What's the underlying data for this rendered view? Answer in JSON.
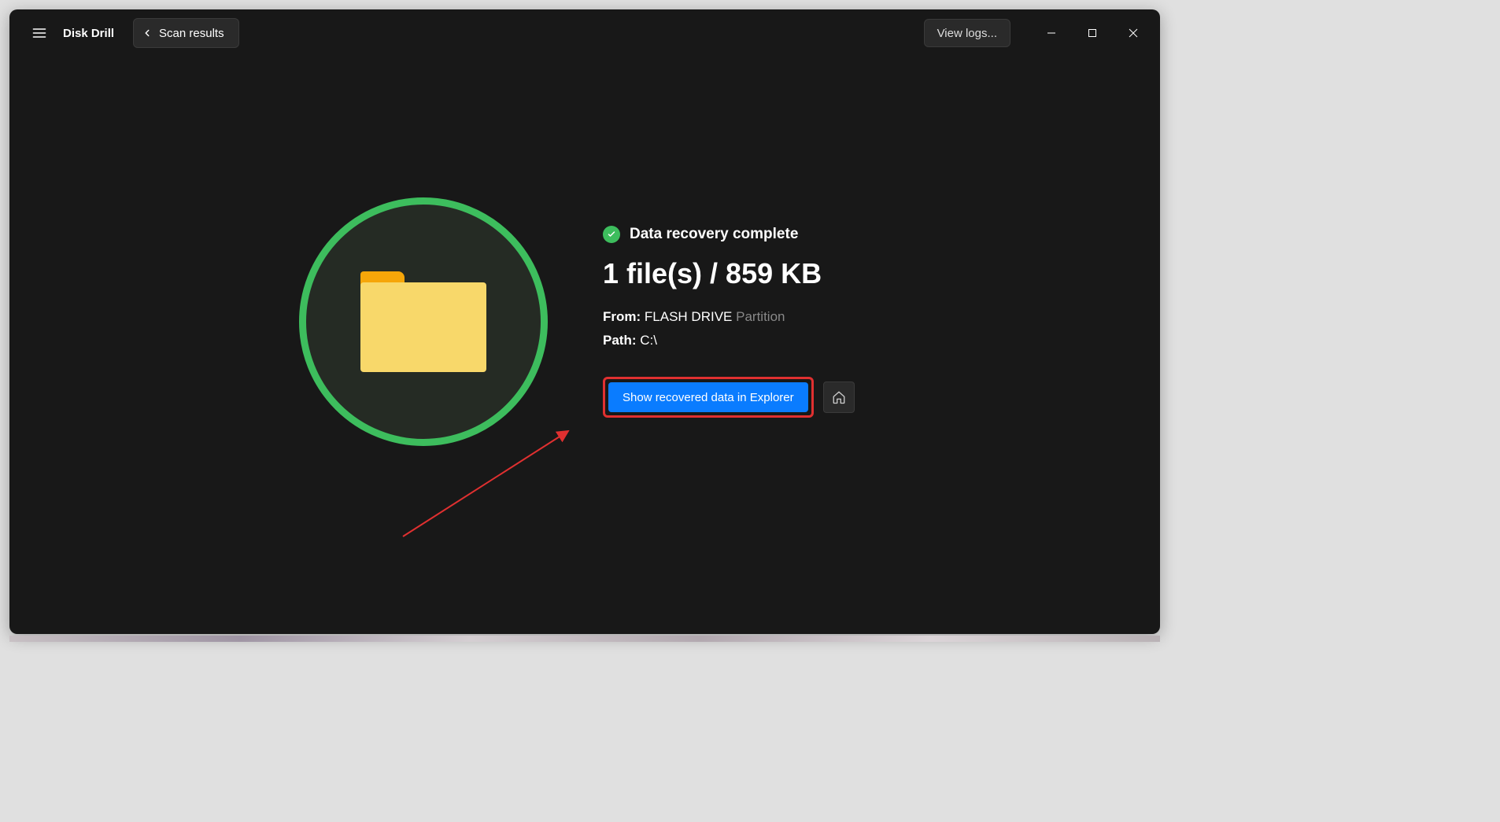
{
  "header": {
    "app_title": "Disk Drill",
    "back_label": "Scan results",
    "view_logs_label": "View logs..."
  },
  "result": {
    "status_text": "Data recovery complete",
    "summary": "1 file(s) / 859 KB",
    "from_label": "From:",
    "from_value": "FLASH DRIVE",
    "from_suffix": "Partition",
    "path_label": "Path:",
    "path_value": "C:\\",
    "primary_button": "Show recovered data in Explorer"
  },
  "icons": {
    "hamburger": "hamburger-icon",
    "chevron_left": "chevron-left-icon",
    "minimize": "minimize-icon",
    "maximize": "maximize-icon",
    "close": "close-icon",
    "check": "check-icon",
    "home": "home-icon",
    "folder": "folder-icon"
  },
  "annotation": {
    "highlight_color": "#e03030",
    "arrow_color": "#e03030"
  }
}
